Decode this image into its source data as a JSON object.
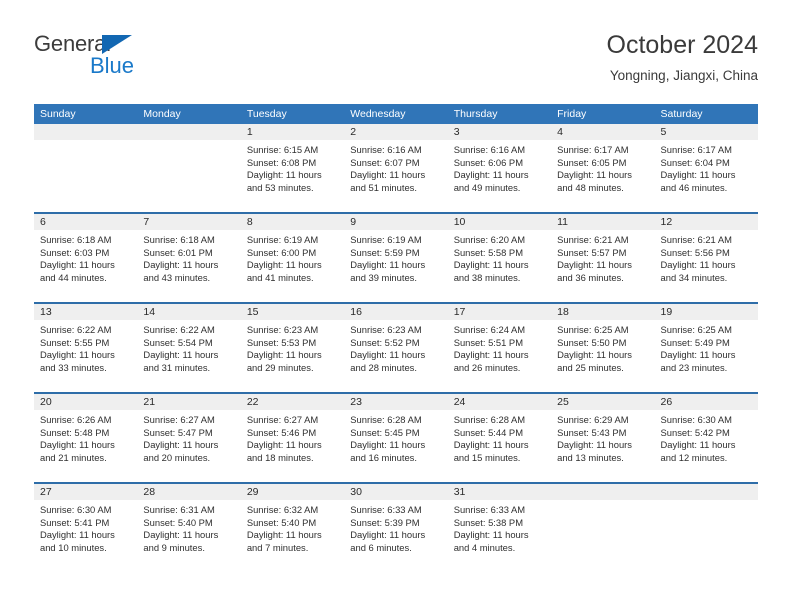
{
  "brand": {
    "name_part1": "General",
    "name_part2": "Blue",
    "triangle_icon": "triangle-icon",
    "accent_color": "#1267b2",
    "blue_text_color": "#1a79c9"
  },
  "header": {
    "title": "October 2024",
    "location": "Yongning, Jiangxi, China"
  },
  "calendar": {
    "header_bg": "#3075b8",
    "day_band_bg": "#efefef",
    "week_divider_color": "#2e6da8",
    "weekdays": [
      "Sunday",
      "Monday",
      "Tuesday",
      "Wednesday",
      "Thursday",
      "Friday",
      "Saturday"
    ],
    "weeks": [
      [
        {
          "day": "",
          "sunrise": "",
          "sunset": "",
          "daylight": "",
          "daylight2": ""
        },
        {
          "day": "",
          "sunrise": "",
          "sunset": "",
          "daylight": "",
          "daylight2": ""
        },
        {
          "day": "1",
          "sunrise": "Sunrise: 6:15 AM",
          "sunset": "Sunset: 6:08 PM",
          "daylight": "Daylight: 11 hours",
          "daylight2": "and 53 minutes."
        },
        {
          "day": "2",
          "sunrise": "Sunrise: 6:16 AM",
          "sunset": "Sunset: 6:07 PM",
          "daylight": "Daylight: 11 hours",
          "daylight2": "and 51 minutes."
        },
        {
          "day": "3",
          "sunrise": "Sunrise: 6:16 AM",
          "sunset": "Sunset: 6:06 PM",
          "daylight": "Daylight: 11 hours",
          "daylight2": "and 49 minutes."
        },
        {
          "day": "4",
          "sunrise": "Sunrise: 6:17 AM",
          "sunset": "Sunset: 6:05 PM",
          "daylight": "Daylight: 11 hours",
          "daylight2": "and 48 minutes."
        },
        {
          "day": "5",
          "sunrise": "Sunrise: 6:17 AM",
          "sunset": "Sunset: 6:04 PM",
          "daylight": "Daylight: 11 hours",
          "daylight2": "and 46 minutes."
        }
      ],
      [
        {
          "day": "6",
          "sunrise": "Sunrise: 6:18 AM",
          "sunset": "Sunset: 6:03 PM",
          "daylight": "Daylight: 11 hours",
          "daylight2": "and 44 minutes."
        },
        {
          "day": "7",
          "sunrise": "Sunrise: 6:18 AM",
          "sunset": "Sunset: 6:01 PM",
          "daylight": "Daylight: 11 hours",
          "daylight2": "and 43 minutes."
        },
        {
          "day": "8",
          "sunrise": "Sunrise: 6:19 AM",
          "sunset": "Sunset: 6:00 PM",
          "daylight": "Daylight: 11 hours",
          "daylight2": "and 41 minutes."
        },
        {
          "day": "9",
          "sunrise": "Sunrise: 6:19 AM",
          "sunset": "Sunset: 5:59 PM",
          "daylight": "Daylight: 11 hours",
          "daylight2": "and 39 minutes."
        },
        {
          "day": "10",
          "sunrise": "Sunrise: 6:20 AM",
          "sunset": "Sunset: 5:58 PM",
          "daylight": "Daylight: 11 hours",
          "daylight2": "and 38 minutes."
        },
        {
          "day": "11",
          "sunrise": "Sunrise: 6:21 AM",
          "sunset": "Sunset: 5:57 PM",
          "daylight": "Daylight: 11 hours",
          "daylight2": "and 36 minutes."
        },
        {
          "day": "12",
          "sunrise": "Sunrise: 6:21 AM",
          "sunset": "Sunset: 5:56 PM",
          "daylight": "Daylight: 11 hours",
          "daylight2": "and 34 minutes."
        }
      ],
      [
        {
          "day": "13",
          "sunrise": "Sunrise: 6:22 AM",
          "sunset": "Sunset: 5:55 PM",
          "daylight": "Daylight: 11 hours",
          "daylight2": "and 33 minutes."
        },
        {
          "day": "14",
          "sunrise": "Sunrise: 6:22 AM",
          "sunset": "Sunset: 5:54 PM",
          "daylight": "Daylight: 11 hours",
          "daylight2": "and 31 minutes."
        },
        {
          "day": "15",
          "sunrise": "Sunrise: 6:23 AM",
          "sunset": "Sunset: 5:53 PM",
          "daylight": "Daylight: 11 hours",
          "daylight2": "and 29 minutes."
        },
        {
          "day": "16",
          "sunrise": "Sunrise: 6:23 AM",
          "sunset": "Sunset: 5:52 PM",
          "daylight": "Daylight: 11 hours",
          "daylight2": "and 28 minutes."
        },
        {
          "day": "17",
          "sunrise": "Sunrise: 6:24 AM",
          "sunset": "Sunset: 5:51 PM",
          "daylight": "Daylight: 11 hours",
          "daylight2": "and 26 minutes."
        },
        {
          "day": "18",
          "sunrise": "Sunrise: 6:25 AM",
          "sunset": "Sunset: 5:50 PM",
          "daylight": "Daylight: 11 hours",
          "daylight2": "and 25 minutes."
        },
        {
          "day": "19",
          "sunrise": "Sunrise: 6:25 AM",
          "sunset": "Sunset: 5:49 PM",
          "daylight": "Daylight: 11 hours",
          "daylight2": "and 23 minutes."
        }
      ],
      [
        {
          "day": "20",
          "sunrise": "Sunrise: 6:26 AM",
          "sunset": "Sunset: 5:48 PM",
          "daylight": "Daylight: 11 hours",
          "daylight2": "and 21 minutes."
        },
        {
          "day": "21",
          "sunrise": "Sunrise: 6:27 AM",
          "sunset": "Sunset: 5:47 PM",
          "daylight": "Daylight: 11 hours",
          "daylight2": "and 20 minutes."
        },
        {
          "day": "22",
          "sunrise": "Sunrise: 6:27 AM",
          "sunset": "Sunset: 5:46 PM",
          "daylight": "Daylight: 11 hours",
          "daylight2": "and 18 minutes."
        },
        {
          "day": "23",
          "sunrise": "Sunrise: 6:28 AM",
          "sunset": "Sunset: 5:45 PM",
          "daylight": "Daylight: 11 hours",
          "daylight2": "and 16 minutes."
        },
        {
          "day": "24",
          "sunrise": "Sunrise: 6:28 AM",
          "sunset": "Sunset: 5:44 PM",
          "daylight": "Daylight: 11 hours",
          "daylight2": "and 15 minutes."
        },
        {
          "day": "25",
          "sunrise": "Sunrise: 6:29 AM",
          "sunset": "Sunset: 5:43 PM",
          "daylight": "Daylight: 11 hours",
          "daylight2": "and 13 minutes."
        },
        {
          "day": "26",
          "sunrise": "Sunrise: 6:30 AM",
          "sunset": "Sunset: 5:42 PM",
          "daylight": "Daylight: 11 hours",
          "daylight2": "and 12 minutes."
        }
      ],
      [
        {
          "day": "27",
          "sunrise": "Sunrise: 6:30 AM",
          "sunset": "Sunset: 5:41 PM",
          "daylight": "Daylight: 11 hours",
          "daylight2": "and 10 minutes."
        },
        {
          "day": "28",
          "sunrise": "Sunrise: 6:31 AM",
          "sunset": "Sunset: 5:40 PM",
          "daylight": "Daylight: 11 hours",
          "daylight2": "and 9 minutes."
        },
        {
          "day": "29",
          "sunrise": "Sunrise: 6:32 AM",
          "sunset": "Sunset: 5:40 PM",
          "daylight": "Daylight: 11 hours",
          "daylight2": "and 7 minutes."
        },
        {
          "day": "30",
          "sunrise": "Sunrise: 6:33 AM",
          "sunset": "Sunset: 5:39 PM",
          "daylight": "Daylight: 11 hours",
          "daylight2": "and 6 minutes."
        },
        {
          "day": "31",
          "sunrise": "Sunrise: 6:33 AM",
          "sunset": "Sunset: 5:38 PM",
          "daylight": "Daylight: 11 hours",
          "daylight2": "and 4 minutes."
        },
        {
          "day": "",
          "sunrise": "",
          "sunset": "",
          "daylight": "",
          "daylight2": ""
        },
        {
          "day": "",
          "sunrise": "",
          "sunset": "",
          "daylight": "",
          "daylight2": ""
        }
      ]
    ]
  }
}
